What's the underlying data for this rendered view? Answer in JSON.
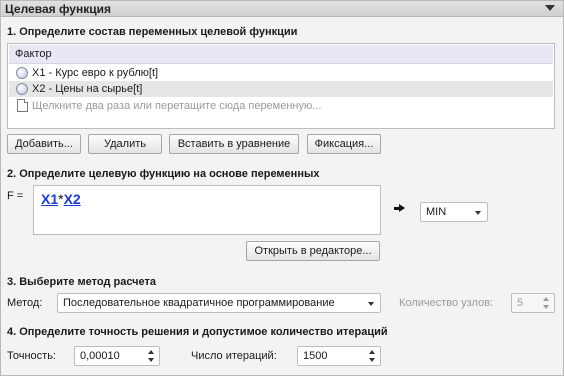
{
  "panel": {
    "title": "Целевая функция"
  },
  "section1": {
    "heading": "1. Определите состав переменных целевой функции",
    "list_header": "Фактор",
    "items": [
      {
        "label": "X1 - Курс евро к рублю[t]",
        "selected": false
      },
      {
        "label": "X2 - Цены на сырье[t]",
        "selected": true
      }
    ],
    "hint": "Щелкните два раза или перетащите сюда переменную...",
    "buttons": {
      "add": "Добавить...",
      "delete": "Удалить",
      "insert": "Вставить в уравнение",
      "fix": "Фиксация..."
    }
  },
  "section2": {
    "heading": "2. Определите целевую функцию на основе переменных",
    "f_label": "F =",
    "formula": {
      "var1": "X1",
      "op": "*",
      "var2": "X2"
    },
    "goal": "MIN",
    "open_editor": "Открыть в редакторе..."
  },
  "section3": {
    "heading": "3. Выберите метод расчета",
    "method_label": "Метод:",
    "method_value": "Последовательное квадратичное программирование",
    "nodes_label": "Количество узлов:",
    "nodes_value": "5"
  },
  "section4": {
    "heading": "4. Определите точность решения и допустимое количество итераций",
    "accuracy_label": "Точность:",
    "accuracy_value": "0,00010",
    "iterations_label": "Число итераций:",
    "iterations_value": "1500"
  }
}
